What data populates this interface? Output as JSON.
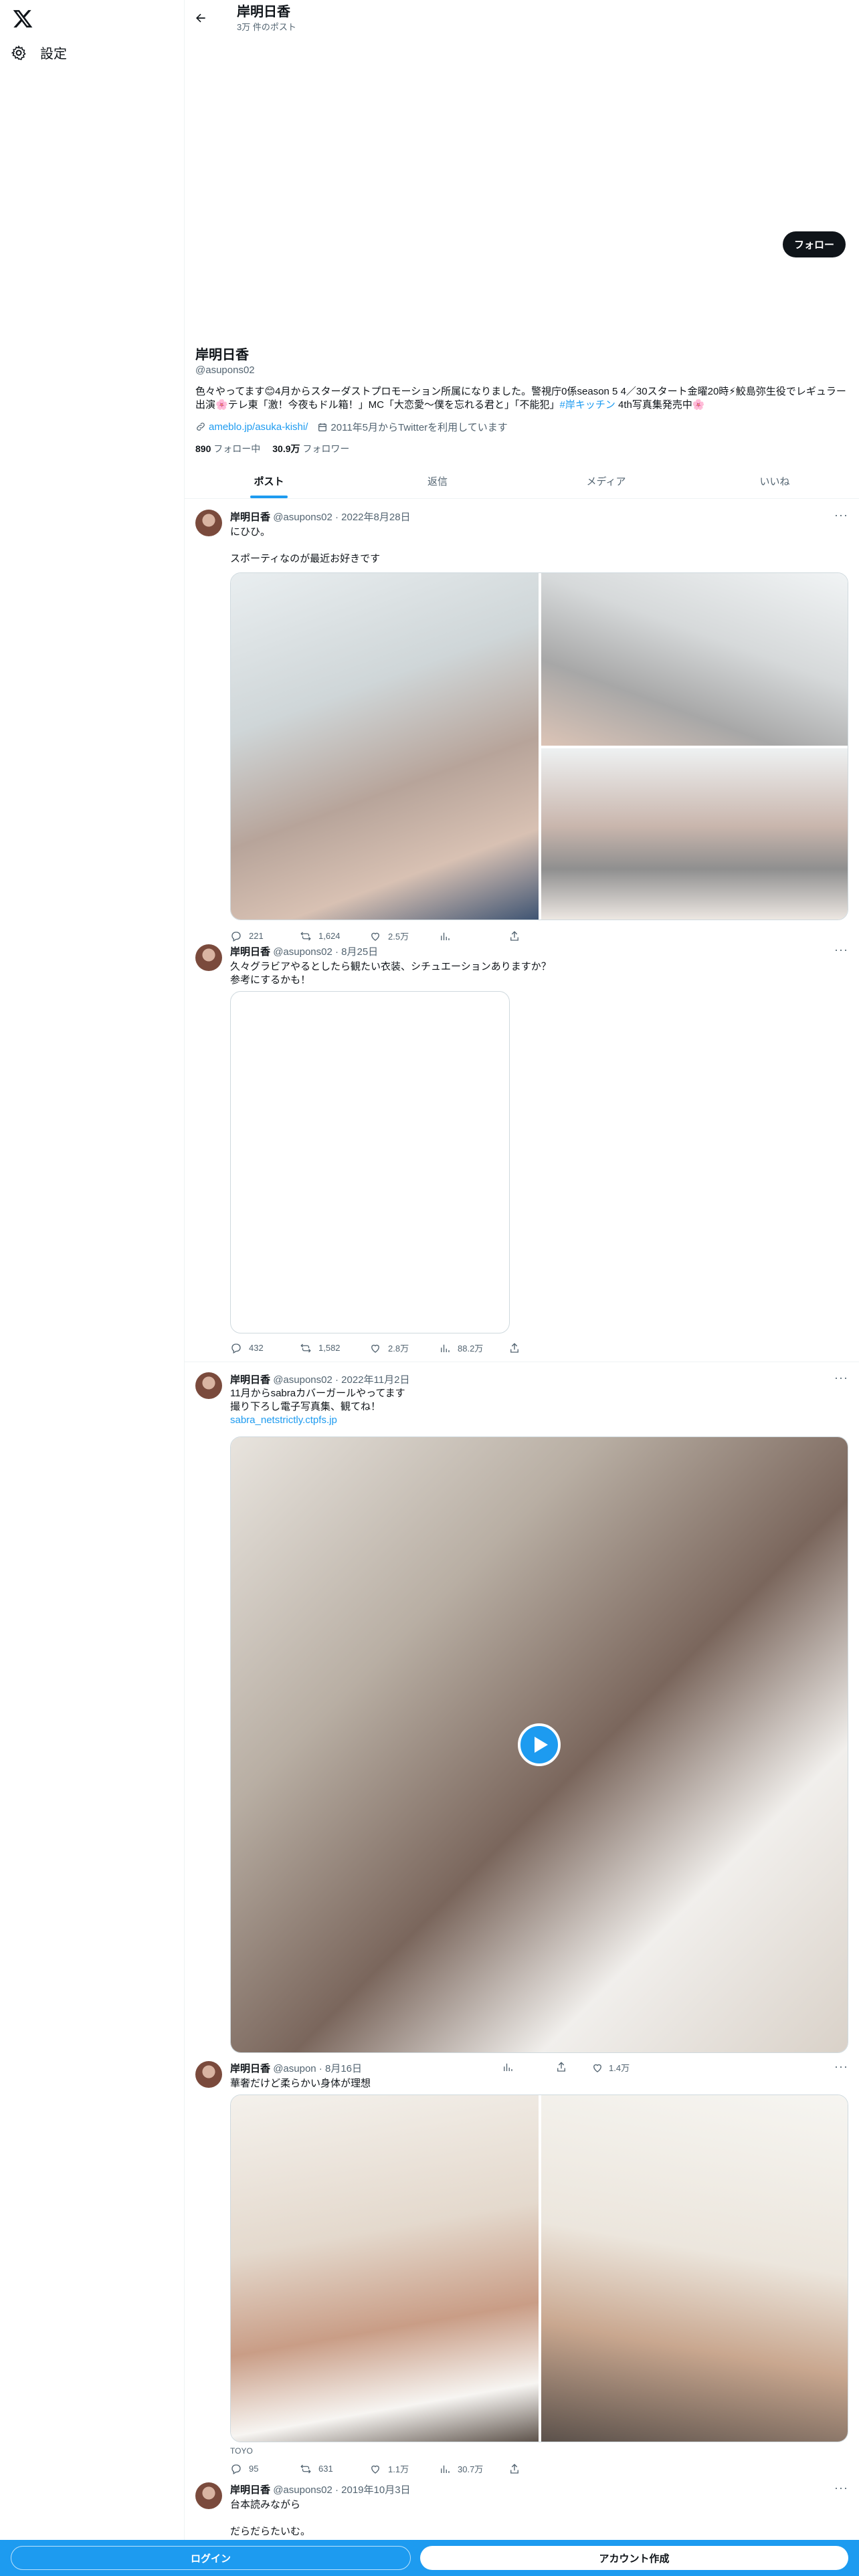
{
  "sidebar": {
    "settings_label": "設定"
  },
  "header": {
    "name": "岸明日香",
    "post_count": "3万 件のポスト"
  },
  "profile": {
    "follow_label": "フォロー",
    "name": "岸明日香",
    "handle": "@asupons02",
    "bio_line1": "色々やってます😊4月からスターダストプロモーション所属になりました。警視庁0係season 5 4／30スタート金曜20時⚡鮫島弥生役でレギュラー",
    "bio_line2_a": "出演🌸テレ東「激！今夜もドル箱！」MC「大恋愛〜僕を忘れる君と」「不能犯」",
    "bio_hashtag": "#岸キッチン",
    "bio_line2_b": " 4th写真集発売中🌸",
    "website": "ameblo.jp/asuka-kishi/",
    "joined": "2011年5月からTwitterを利用しています",
    "following_count": "890",
    "following_label": " フォロー中",
    "followers_count": "30.9万",
    "followers_label": " フォロワー"
  },
  "tabs": [
    "ポスト",
    "返信",
    "メディア",
    "いいね"
  ],
  "posts": [
    {
      "name": "岸明日香",
      "handle": "@asupons02",
      "date": "2022年8月28日",
      "text": "にひひ。\n\nスポーティなのが最近お好きです",
      "replies": "221",
      "reposts": "1,624",
      "likes": "2.5万",
      "views": ""
    },
    {
      "name": "岸明日香",
      "handle": "@asupons02",
      "date": "8月25日",
      "text": "久々グラビアやるとしたら観たい衣装、シチュエーションありますか？\n参考にするかも！",
      "replies": "432",
      "reposts": "1,582",
      "likes": "2.8万",
      "views": "88.2万"
    },
    {
      "name": "岸明日香",
      "handle": "@asupons02",
      "date": "2022年11月2日",
      "text": "11月からsabraカバーガールやってます\n撮り下ろし電子写真集、観てね！",
      "link": "sabra_netstrictly.ctpfs.jp"
    },
    {
      "name": "岸明日香",
      "handle": "@asupon",
      "date": "8月16日",
      "text": "華奢だけど柔らかい身体が理想",
      "likes_top": "1.4万",
      "caption": "TOYO",
      "replies": "95",
      "reposts": "631",
      "likes": "1.1万",
      "views": "30.7万"
    },
    {
      "name": "岸明日香",
      "handle": "@asupons02",
      "date": "2019年10月3日",
      "text": "台本読みながら\n\nだらだらたいむ。"
    }
  ],
  "bottom": {
    "login_label": "ログイン",
    "signup_label": "アカウント作成"
  }
}
